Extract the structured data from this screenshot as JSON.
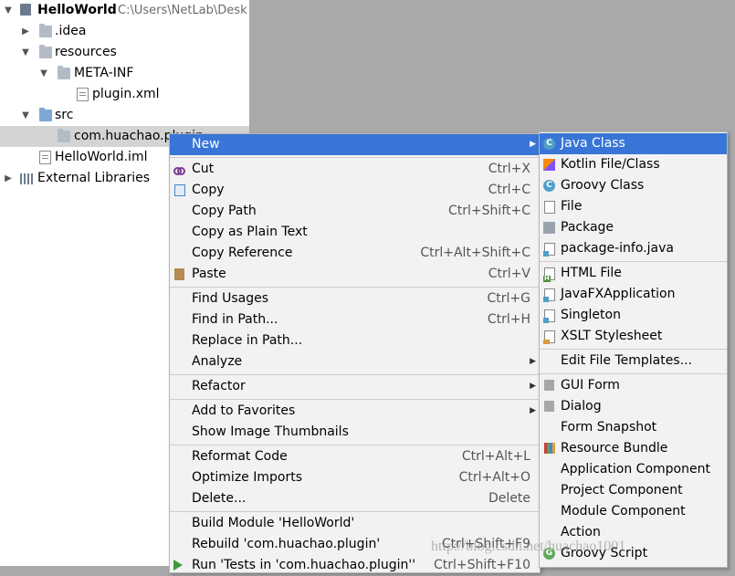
{
  "project_tree": {
    "root": {
      "name": "HelloWorld",
      "path": "C:\\Users\\NetLab\\Desk"
    },
    "items": [
      {
        "label": ".idea"
      },
      {
        "label": "resources"
      },
      {
        "label": "META-INF"
      },
      {
        "label": "plugin.xml"
      },
      {
        "label": "src"
      },
      {
        "label": "com.huachao.plugin"
      },
      {
        "label": "HelloWorld.iml"
      },
      {
        "label": "External Libraries"
      }
    ]
  },
  "context_menu": {
    "items": [
      {
        "label": "New"
      },
      {
        "label": "Cut",
        "shortcut": "Ctrl+X"
      },
      {
        "label": "Copy",
        "shortcut": "Ctrl+C"
      },
      {
        "label": "Copy Path",
        "shortcut": "Ctrl+Shift+C"
      },
      {
        "label": "Copy as Plain Text"
      },
      {
        "label": "Copy Reference",
        "shortcut": "Ctrl+Alt+Shift+C"
      },
      {
        "label": "Paste",
        "shortcut": "Ctrl+V"
      },
      {
        "label": "Find Usages",
        "shortcut": "Ctrl+G"
      },
      {
        "label": "Find in Path...",
        "shortcut": "Ctrl+H"
      },
      {
        "label": "Replace in Path..."
      },
      {
        "label": "Analyze"
      },
      {
        "label": "Refactor"
      },
      {
        "label": "Add to Favorites"
      },
      {
        "label": "Show Image Thumbnails"
      },
      {
        "label": "Reformat Code",
        "shortcut": "Ctrl+Alt+L"
      },
      {
        "label": "Optimize Imports",
        "shortcut": "Ctrl+Alt+O"
      },
      {
        "label": "Delete...",
        "shortcut": "Delete"
      },
      {
        "label": "Build Module 'HelloWorld'"
      },
      {
        "label": "Rebuild 'com.huachao.plugin'",
        "shortcut": "Ctrl+Shift+F9"
      },
      {
        "label": "Run 'Tests in 'com.huachao.plugin''",
        "shortcut": "Ctrl+Shift+F10"
      }
    ]
  },
  "new_submenu": {
    "items": [
      {
        "label": "Java Class"
      },
      {
        "label": "Kotlin File/Class"
      },
      {
        "label": "Groovy Class"
      },
      {
        "label": "File"
      },
      {
        "label": "Package"
      },
      {
        "label": "package-info.java"
      },
      {
        "label": "HTML File"
      },
      {
        "label": "JavaFXApplication"
      },
      {
        "label": "Singleton"
      },
      {
        "label": "XSLT Stylesheet"
      },
      {
        "label": "Edit File Templates..."
      },
      {
        "label": "GUI Form"
      },
      {
        "label": "Dialog"
      },
      {
        "label": "Form Snapshot"
      },
      {
        "label": "Resource Bundle"
      },
      {
        "label": "Application Component"
      },
      {
        "label": "Project Component"
      },
      {
        "label": "Module Component"
      },
      {
        "label": "Action"
      },
      {
        "label": "Groovy Script"
      }
    ]
  },
  "watermark": "http://blog.csdn.net/huachao1001",
  "colors": {
    "highlight": "#3875d7",
    "menu_bg": "#f2f2f2",
    "editor_bg": "#a9a9a9",
    "selected_row": "#d4d4d4"
  }
}
